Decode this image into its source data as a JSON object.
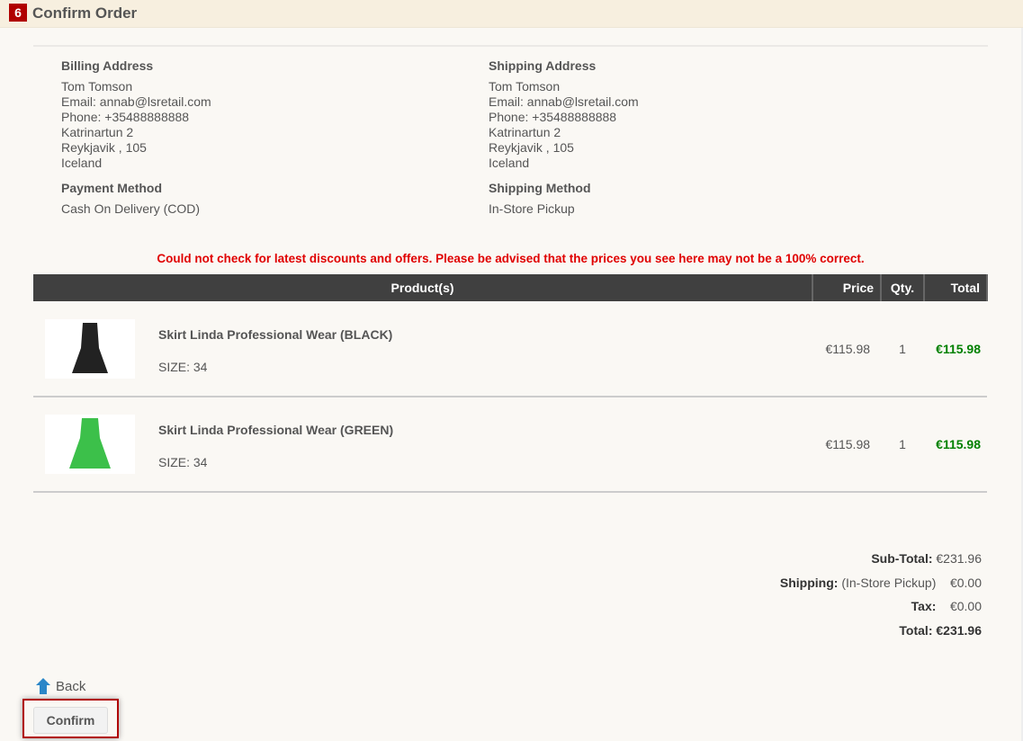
{
  "header": {
    "step": "6",
    "title": "Confirm Order"
  },
  "billing": {
    "heading": "Billing Address",
    "lines": [
      "Tom Tomson",
      "Email: annab@lsretail.com",
      "Phone: +35488888888",
      "Katrinartun 2",
      "Reykjavik , 105",
      "Iceland"
    ]
  },
  "shipping": {
    "heading": "Shipping Address",
    "lines": [
      "Tom Tomson",
      "Email: annab@lsretail.com",
      "Phone: +35488888888",
      "Katrinartun 2",
      "Reykjavik , 105",
      "Iceland"
    ]
  },
  "payment": {
    "heading": "Payment Method",
    "value": "Cash On Delivery (COD)"
  },
  "shipping_method": {
    "heading": "Shipping Method",
    "value": "In-Store Pickup"
  },
  "warning": "Could not check for latest discounts and offers. Please be advised that the prices you see here may not be a 100% correct.",
  "table": {
    "headers": [
      "Product(s)",
      "Price",
      "Qty.",
      "Total"
    ],
    "rows": [
      {
        "name": "Skirt Linda Professional Wear (BLACK)",
        "size": "SIZE: 34",
        "price": "€115.98",
        "qty": "1",
        "total": "€115.98",
        "color": "#222222"
      },
      {
        "name": "Skirt Linda Professional Wear (GREEN)",
        "size": "SIZE: 34",
        "price": "€115.98",
        "qty": "1",
        "total": "€115.98",
        "color": "#3cc04a"
      }
    ]
  },
  "totals": {
    "subtotal_label": "Sub-Total:",
    "subtotal": "€231.96",
    "shipping_label": "Shipping:",
    "shipping_note": "(In-Store Pickup)",
    "shipping": "€0.00",
    "tax_label": "Tax:",
    "tax": "€0.00",
    "total_label": "Total:",
    "total": "€231.96"
  },
  "actions": {
    "back": "Back",
    "confirm": "Confirm"
  }
}
